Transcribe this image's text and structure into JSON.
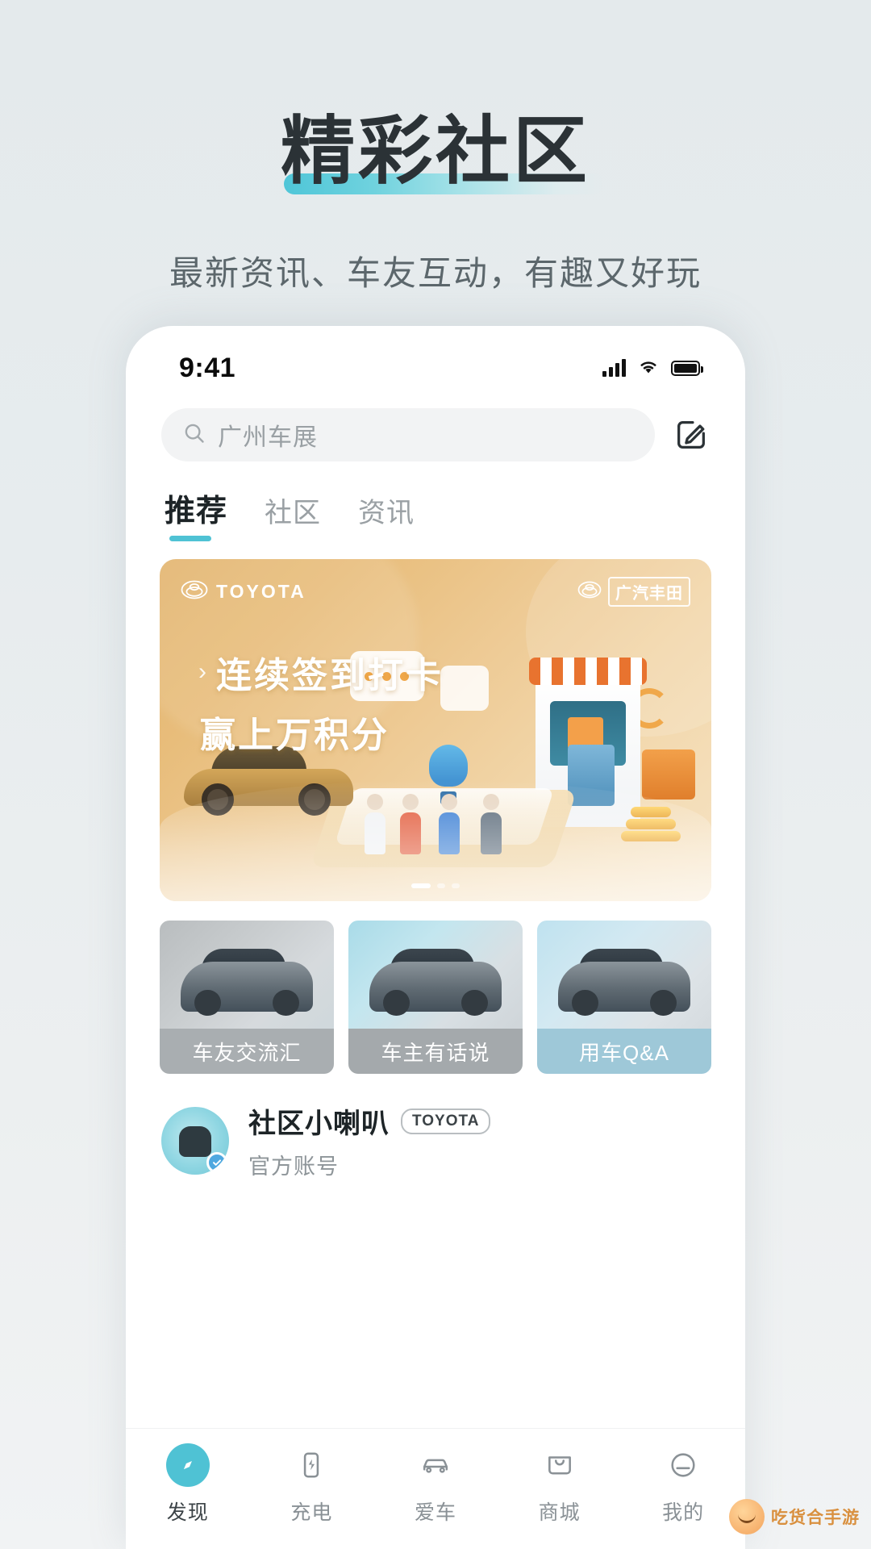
{
  "hero": {
    "title": "精彩社区",
    "subtitle": "最新资讯、车友互动，有趣又好玩",
    "accent_color": "#4fc2d4",
    "background_color": "#e6ebed",
    "title_color": "#2b3236",
    "subtitle_color": "#5c676c"
  },
  "phone": {
    "status_bar": {
      "time": "9:41",
      "signal_icon": "signal-bars-icon",
      "wifi_icon": "wifi-icon",
      "battery_icon": "battery-full-icon"
    },
    "search": {
      "icon": "search-icon",
      "value": "广州车展",
      "placeholder": "广州车展",
      "compose_icon": "compose-edit-icon"
    },
    "tabs": [
      {
        "label": "推荐",
        "active": true
      },
      {
        "label": "社区",
        "active": false
      },
      {
        "label": "资讯",
        "active": false
      }
    ],
    "banner": {
      "brand_logo": "toyota-logo-icon",
      "brand_text": "TOYOTA",
      "partner_logo": "gac-toyota-logo-icon",
      "partner_text": "广汽丰田",
      "chevron": "›",
      "headline_line1": "连续签到打卡",
      "headline_line2": "赢上万积分",
      "dots": {
        "total": 3,
        "active_index": 0
      },
      "background_color": "#e8bd7b"
    },
    "cards": [
      {
        "label": "车友交流汇",
        "caption_color": "#a9aeb1"
      },
      {
        "label": "车主有话说",
        "caption_color": "#a4a9ac"
      },
      {
        "label": "用车Q&A",
        "caption_color": "#9ec8d8"
      }
    ],
    "account": {
      "avatar_icon": "community-avatar-icon",
      "verified_icon": "verified-badge-icon",
      "name": "社区小喇叭",
      "tag": "TOYOTA",
      "subtitle": "官方账号"
    },
    "tabbar": [
      {
        "label": "发现",
        "icon": "compass-discover-icon",
        "active": true
      },
      {
        "label": "充电",
        "icon": "charging-bolt-icon",
        "active": false
      },
      {
        "label": "爱车",
        "icon": "car-icon",
        "active": false
      },
      {
        "label": "商城",
        "icon": "shop-bag-icon",
        "active": false
      },
      {
        "label": "我的",
        "icon": "profile-icon",
        "active": false
      }
    ]
  },
  "watermark": {
    "text": "吃货合手游",
    "icon": "watermark-face-icon"
  }
}
